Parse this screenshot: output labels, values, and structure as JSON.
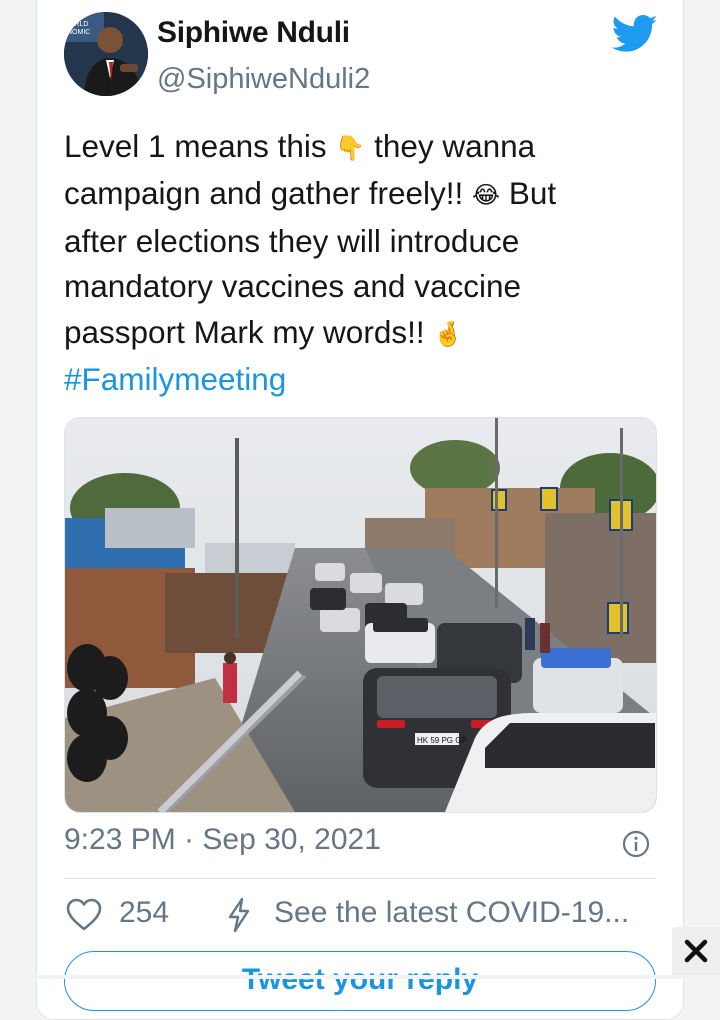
{
  "tweet": {
    "author_name": "Siphiwe Nduli",
    "author_handle": "@SiphiweNduli2",
    "text_lines": [
      "Level 1 means this",
      "they wanna",
      "campaign and gather freely!!",
      "But",
      "after elections they will introduce",
      "mandatory vaccines and vaccine",
      "passport Mark my words!!"
    ],
    "emojis": {
      "pointing_down": "👇",
      "tears_of_joy": "😂",
      "crossed_fingers": "🤞"
    },
    "hashtag": "#Familymeeting",
    "timestamp": "9:23 PM · Sep 30, 2021",
    "likes": "254",
    "covid_link": "See the latest COVID-19...",
    "reply_button": "Tweet your reply"
  },
  "photo": {
    "license_plate": "HK 59 PG GP"
  },
  "colors": {
    "twitter_blue": "#1d9bf0",
    "link_blue": "#1b95e0",
    "muted_text": "#657786",
    "border": "#dde3e8"
  },
  "icons": [
    "twitter-bird-icon",
    "info-icon",
    "heart-icon",
    "bolt-icon",
    "close-icon"
  ]
}
